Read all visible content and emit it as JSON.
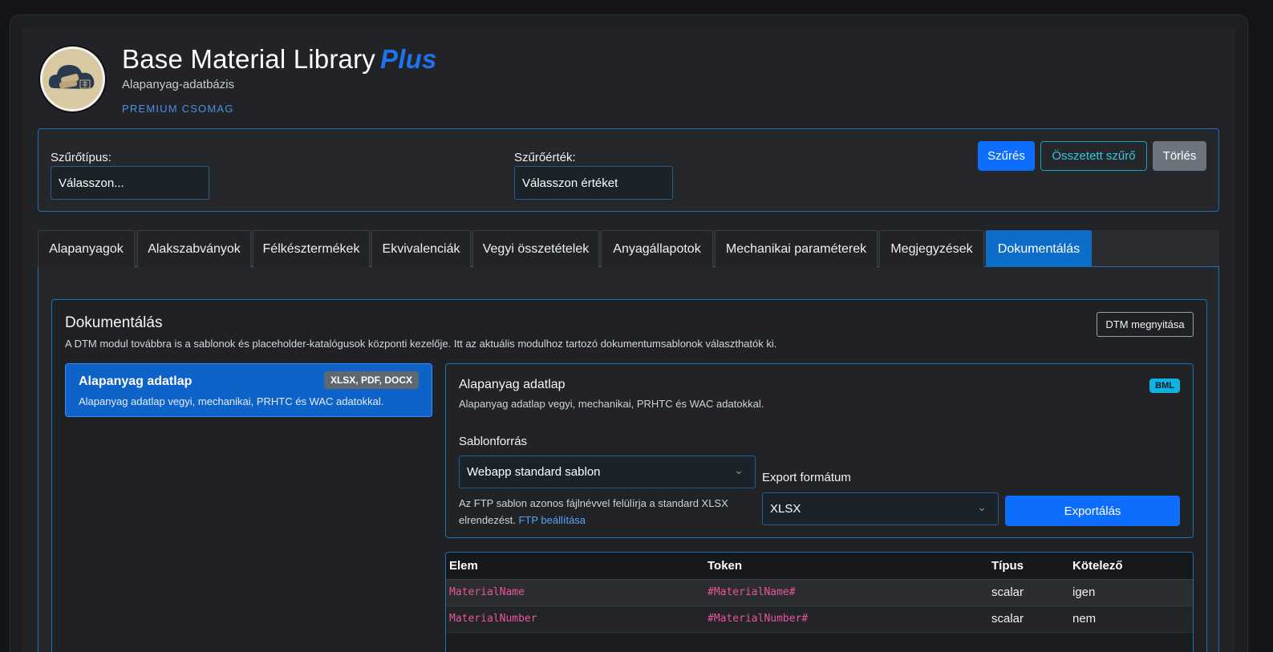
{
  "header": {
    "title": "Base Material Library",
    "title_accent": "Plus",
    "subtitle": "Alapanyag-adatbázis",
    "package": "PREMIUM CSOMAG",
    "logo_icon": "cloud-materials-icon"
  },
  "filter": {
    "type_label": "Szűrőtípus:",
    "type_value": "Válasszon...",
    "value_label": "Szűrőérték:",
    "value_value": "Válasszon értéket",
    "filter_btn": "Szűrés",
    "complex_btn": "Összetett szűrő",
    "clear_btn": "Törlés"
  },
  "tabs": [
    {
      "label": "Alapanyagok"
    },
    {
      "label": "Alakszabványok"
    },
    {
      "label": "Félkésztermékek"
    },
    {
      "label": "Ekvivalenciák"
    },
    {
      "label": "Vegyi összetételek"
    },
    {
      "label": "Anyagállapotok"
    },
    {
      "label": "Mechanikai paraméterek"
    },
    {
      "label": "Megjegyzések"
    },
    {
      "label": "Dokumentálás"
    }
  ],
  "active_tab": "Dokumentálás",
  "docs": {
    "title": "Dokumentálás",
    "description": "A DTM modul továbbra is a sablonok és placeholder-katalógusok központi kezelője. Itt az aktuális modulhoz tartozó dokumentumsablonok választhatók ki.",
    "open_dtm_btn": "DTM megnyitása",
    "template_item": {
      "name": "Alapanyag adatlap",
      "formats": "XLSX, PDF, DOCX",
      "description": "Alapanyag adatlap vegyi, mechanikai, PRHTC és WAC adatokkal."
    },
    "detail": {
      "name": "Alapanyag adatlap",
      "badge": "BML",
      "description": "Alapanyag adatlap vegyi, mechanikai, PRHTC és WAC adatokkal.",
      "source_label": "Sablonforrás",
      "source_value": "Webapp standard sablon",
      "hint_text": "Az FTP sablon azonos fájlnévvel felülírja a standard XLSX elrendezést.",
      "hint_link": "FTP beállítása",
      "export_label": "Export formátum",
      "export_value": "XLSX",
      "export_btn": "Exportálás"
    },
    "table": {
      "headers": [
        "Elem",
        "Token",
        "Típus",
        "Kötelező"
      ],
      "rows": [
        {
          "elem": "MaterialName",
          "token": "#MaterialName#",
          "tipus": "scalar",
          "kotelezo": "igen"
        },
        {
          "elem": "MaterialNumber",
          "token": "#MaterialNumber#",
          "tipus": "scalar",
          "kotelezo": "nem"
        }
      ]
    }
  }
}
